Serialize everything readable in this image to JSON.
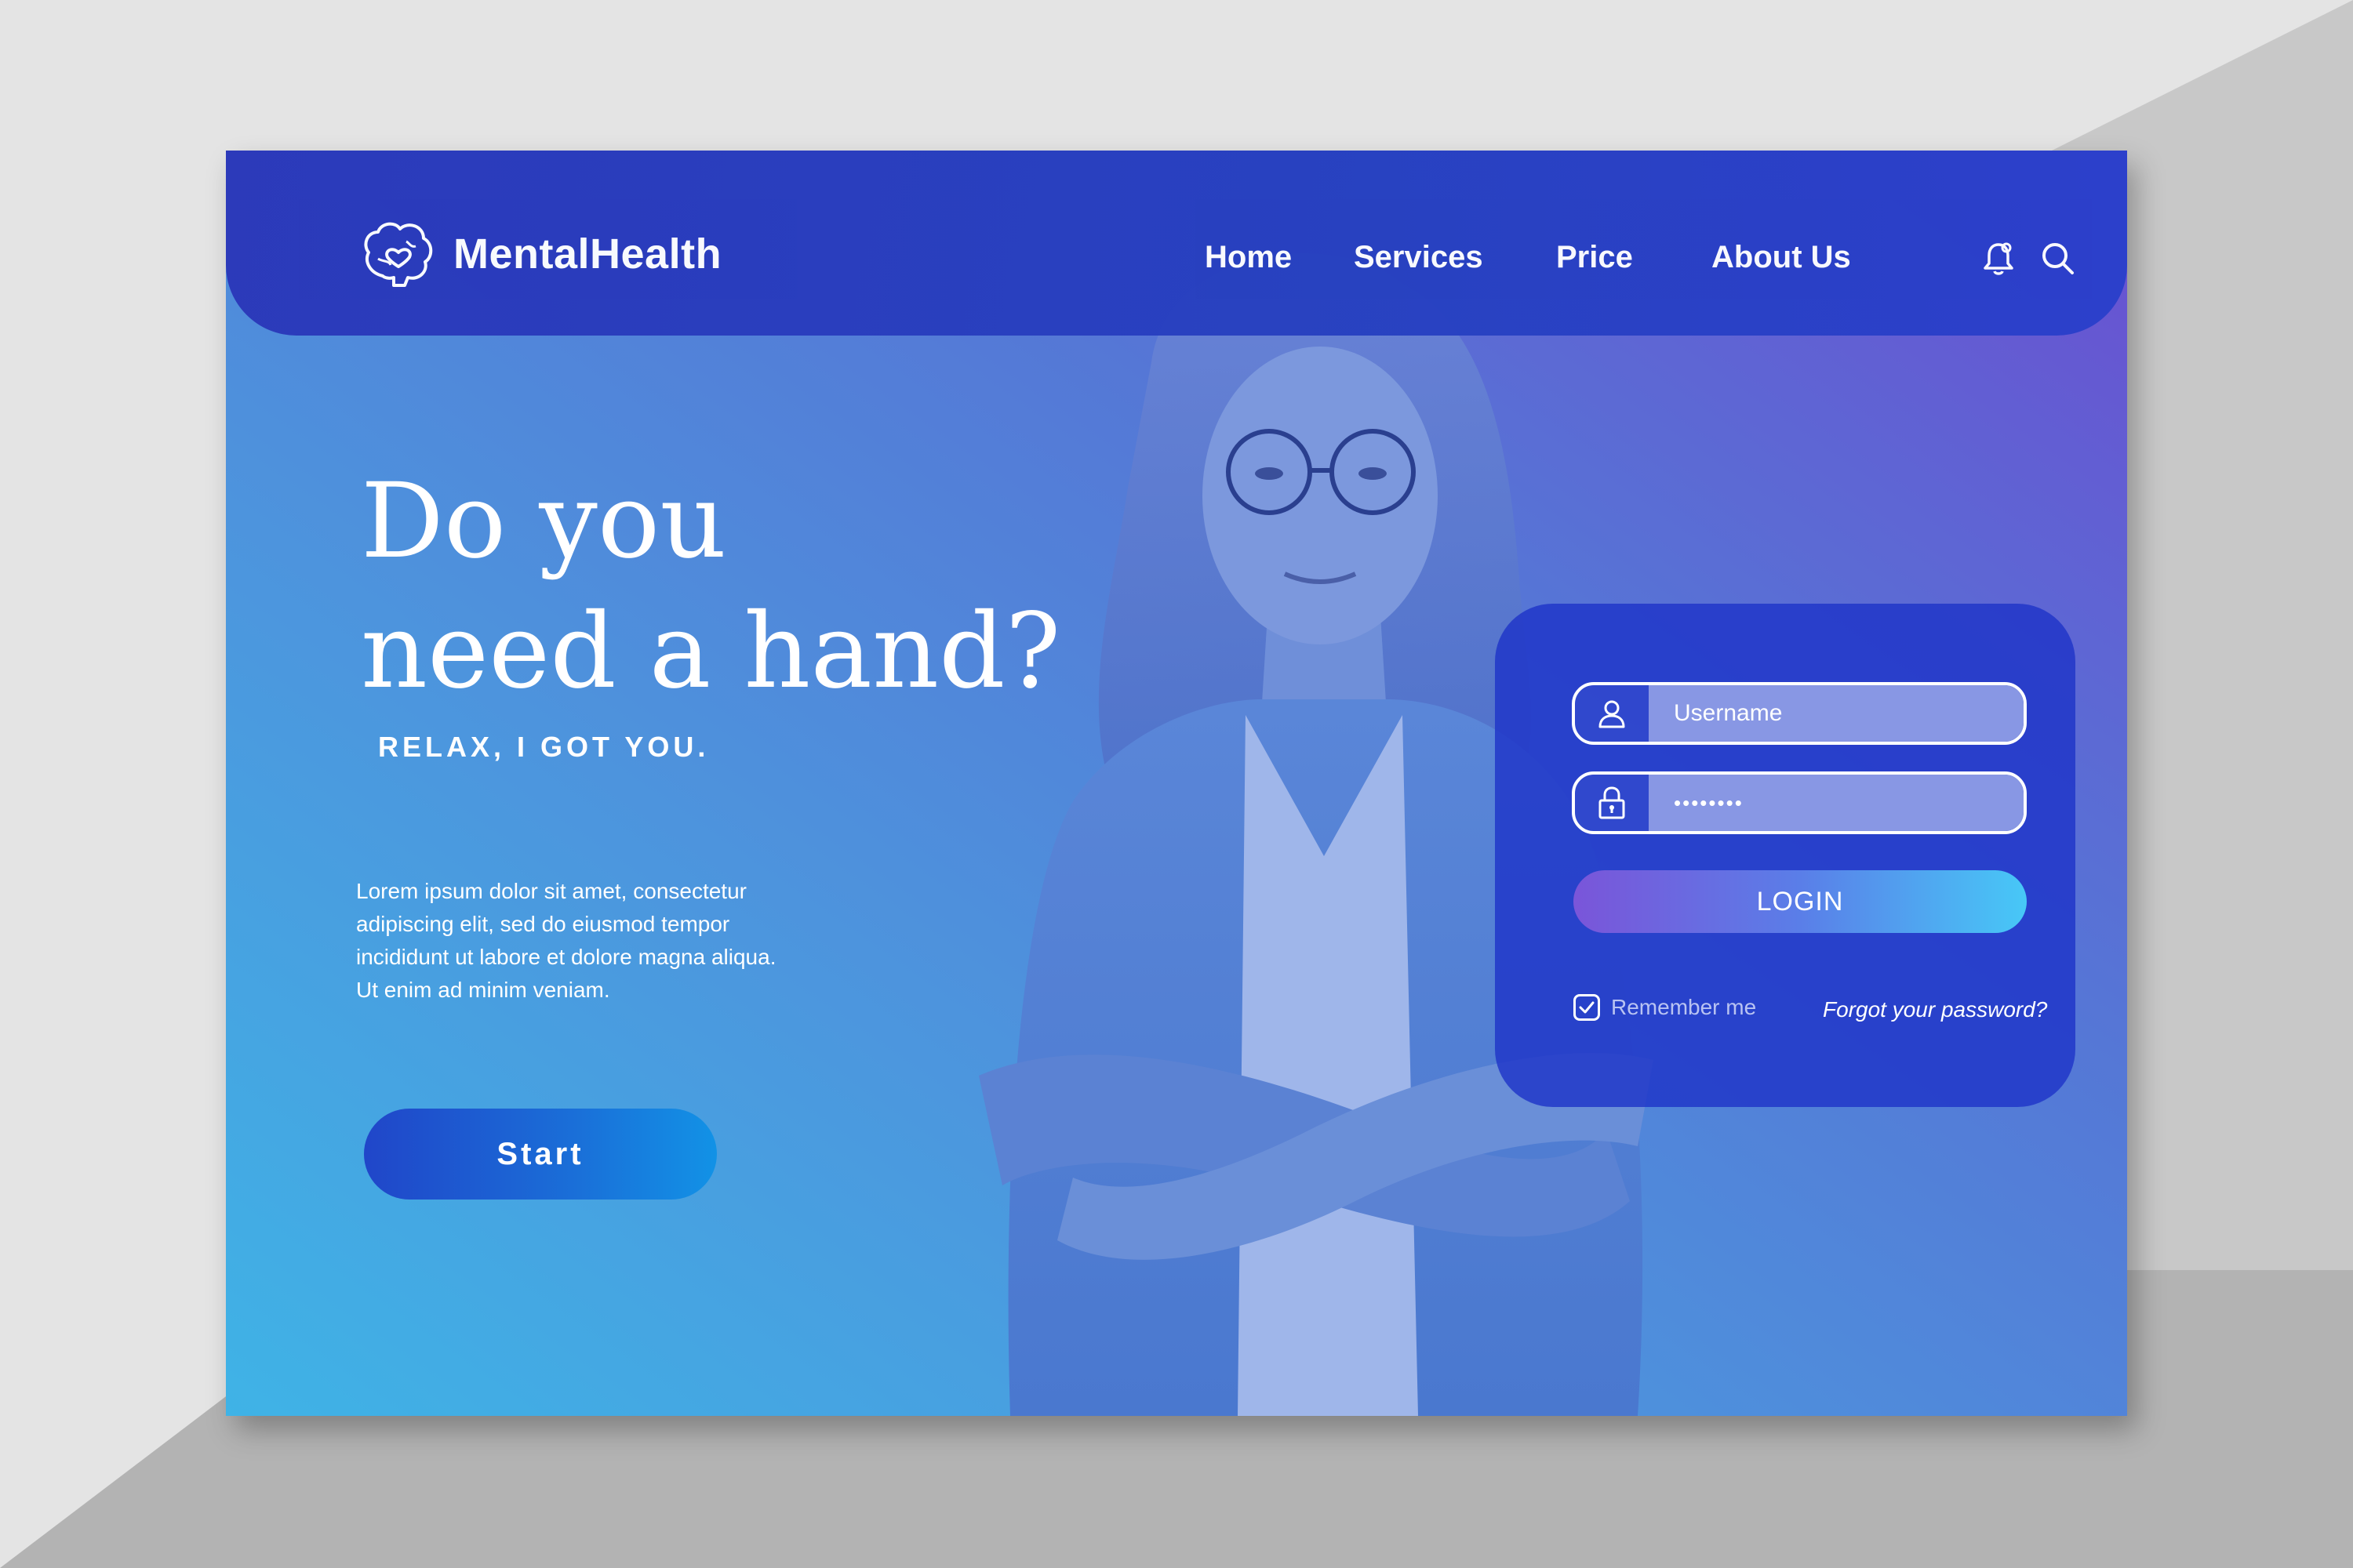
{
  "brand": {
    "name": "MentalHealth",
    "logo_icon": "brain-heart-icon"
  },
  "nav": {
    "items": [
      {
        "label": "Home"
      },
      {
        "label": "Services"
      },
      {
        "label": "Price"
      },
      {
        "label": "About Us"
      }
    ],
    "icons": [
      "bell-icon",
      "search-icon"
    ]
  },
  "hero": {
    "headline_line1": "Do you",
    "headline_line2": "need a hand?",
    "subheading": "RELAX, I GOT YOU.",
    "paragraph_lines": [
      "Lorem ipsum dolor sit amet, consectetur",
      "adipiscing elit, sed do eiusmod tempor",
      "incididunt ut labore et dolore magna aliqua.",
      "Ut enim ad minim veniam."
    ],
    "start_label": "Start"
  },
  "login": {
    "username_placeholder": "Username",
    "password_value": "••••••••",
    "login_label": "LOGIN",
    "remember_label": "Remember me",
    "remember_checked": true,
    "forgot_label": "Forgot your password?"
  },
  "colors": {
    "header": "#2a3cc2",
    "accent_gradient_start": "#7a55d9",
    "accent_gradient_end": "#47c8f7",
    "start_button": "#1f55cc"
  }
}
